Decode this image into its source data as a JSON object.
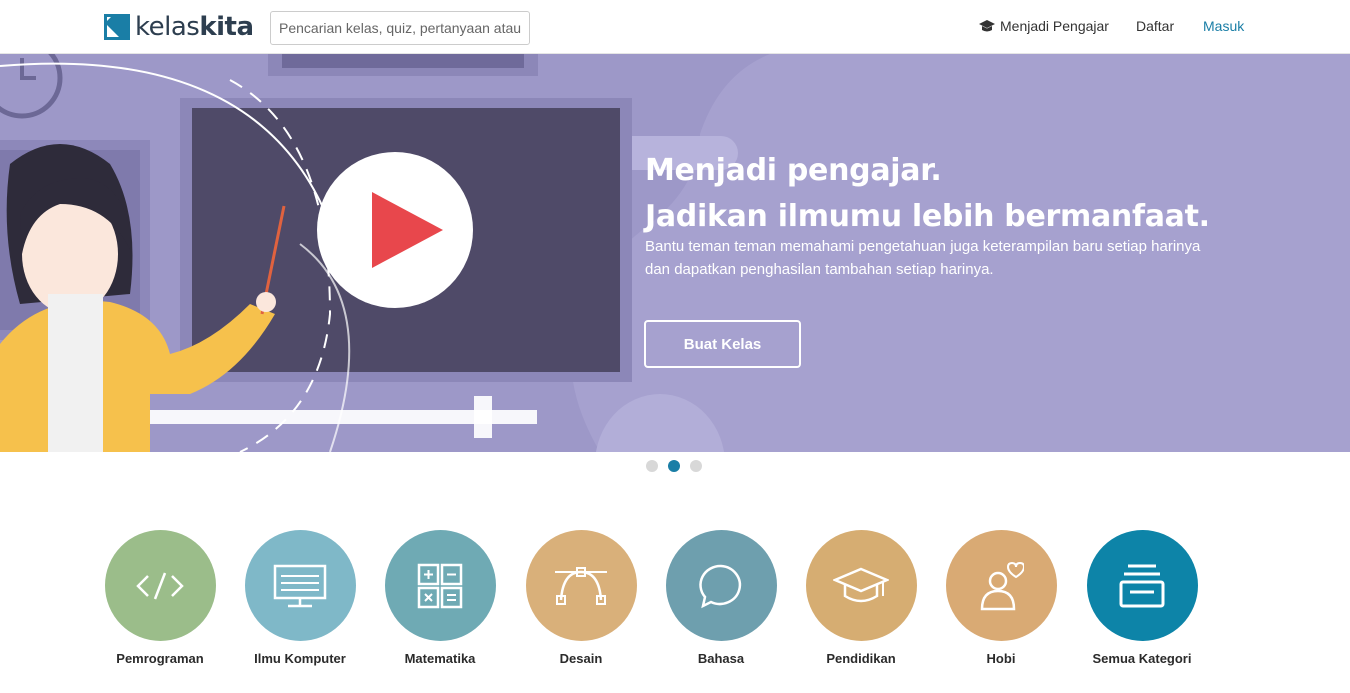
{
  "header": {
    "logo_light": "kelas",
    "logo_bold": "kita",
    "search_placeholder": "Pencarian kelas, quiz, pertanyaan atau",
    "nav_teach": "Menjadi Pengajar",
    "nav_signup": "Daftar",
    "nav_login": "Masuk"
  },
  "hero": {
    "title_line1": "Menjadi pengajar.",
    "title_line2": "Jadikan ilmumu lebih bermanfaat.",
    "subtitle_line1": "Bantu teman teman memahami pengetahuan juga keterampilan baru setiap harinya",
    "subtitle_line2": "dan dapatkan penghasilan tambahan setiap harinya.",
    "cta_label": "Buat Kelas"
  },
  "carousel": {
    "slides": 3,
    "active_index": 1
  },
  "categories": [
    {
      "label": "Pemrograman",
      "icon": "code-icon",
      "color": "#9bbd8a"
    },
    {
      "label": "Ilmu Komputer",
      "icon": "monitor-icon",
      "color": "#7fb8c8"
    },
    {
      "label": "Matematika",
      "icon": "calculator-icon",
      "color": "#6faab4"
    },
    {
      "label": "Desain",
      "icon": "bezier-pen-icon",
      "color": "#d9b07a"
    },
    {
      "label": "Bahasa",
      "icon": "chat-bubble-icon",
      "color": "#6e9fae"
    },
    {
      "label": "Pendidikan",
      "icon": "graduation-cap-icon",
      "color": "#d6ad72"
    },
    {
      "label": "Hobi",
      "icon": "person-heart-icon",
      "color": "#d9aa74"
    },
    {
      "label": "Semua Kategori",
      "icon": "stack-icon",
      "color": "#0d84a8"
    }
  ],
  "colors": {
    "brand": "#1a7ea6",
    "hero_bg": "#9d98c8"
  }
}
